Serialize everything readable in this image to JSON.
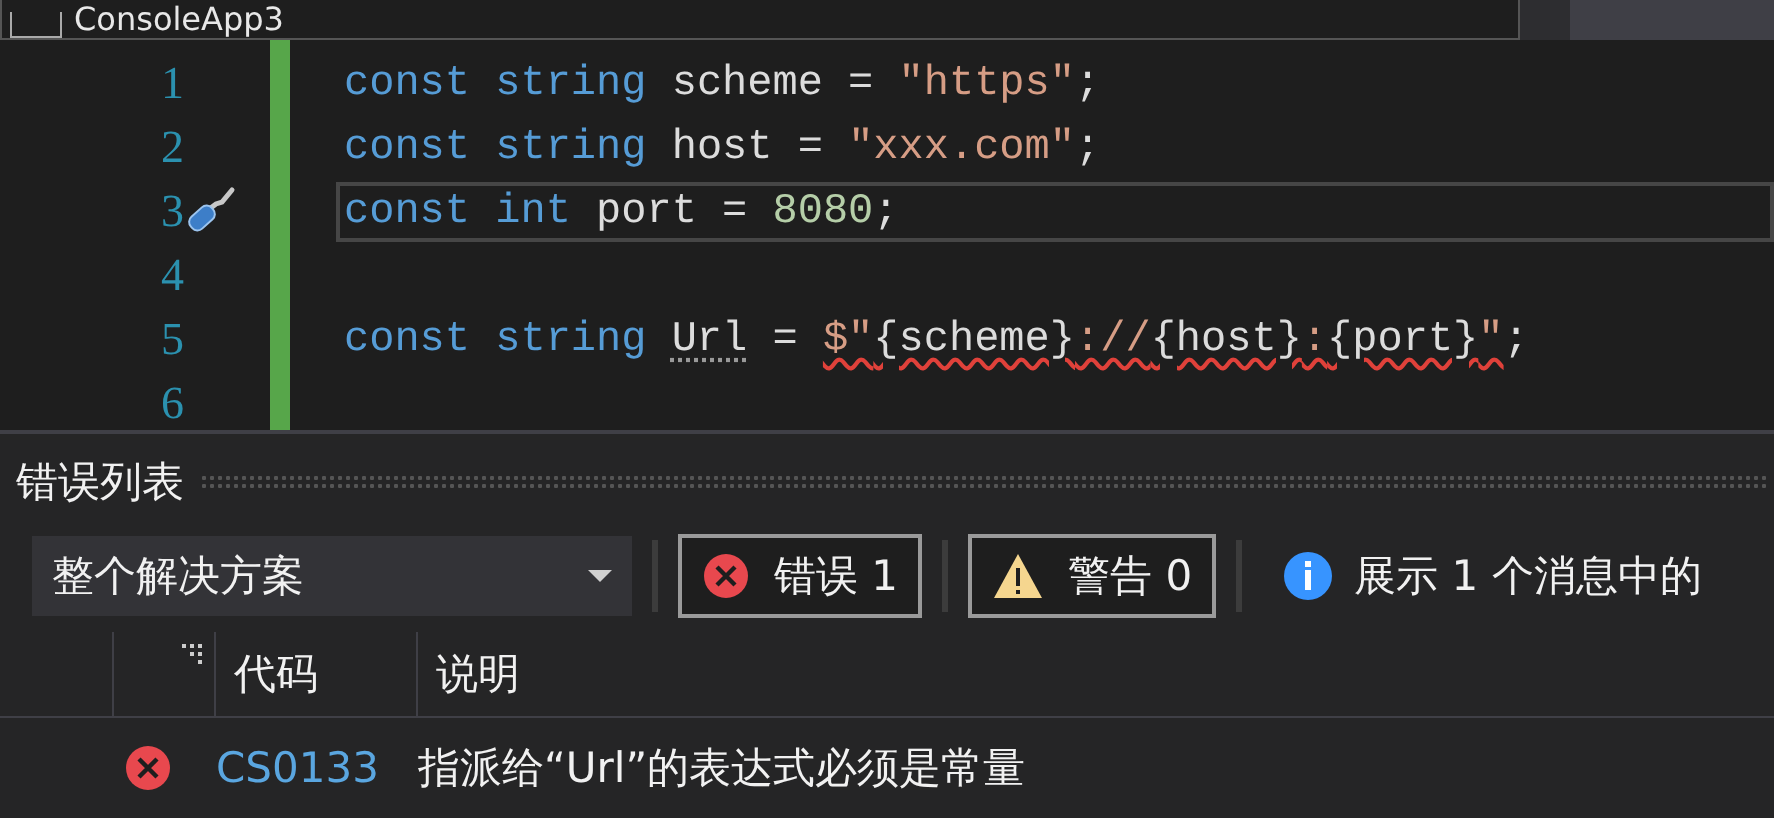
{
  "window": {
    "title": "ConsoleApp3"
  },
  "editor": {
    "lines": [
      {
        "number": "1",
        "current": false,
        "quick_action": false,
        "tokens": [
          {
            "kind": "keyword",
            "text": "const string"
          },
          {
            "kind": "plain",
            "text": " scheme = "
          },
          {
            "kind": "string",
            "text": "\"https\""
          },
          {
            "kind": "plain",
            "text": ";"
          }
        ]
      },
      {
        "number": "2",
        "current": false,
        "quick_action": false,
        "tokens": [
          {
            "kind": "keyword",
            "text": "const string"
          },
          {
            "kind": "plain",
            "text": " host = "
          },
          {
            "kind": "string",
            "text": "\"xxx.com\""
          },
          {
            "kind": "plain",
            "text": ";"
          }
        ]
      },
      {
        "number": "3",
        "current": true,
        "quick_action": true,
        "tokens": [
          {
            "kind": "keyword",
            "text": "const int"
          },
          {
            "kind": "plain",
            "text": " port = "
          },
          {
            "kind": "number",
            "text": "8080"
          },
          {
            "kind": "plain",
            "text": ";"
          }
        ]
      },
      {
        "number": "4",
        "current": false,
        "quick_action": false
      },
      {
        "number": "5",
        "current": false,
        "quick_action": false,
        "tokens": [
          {
            "kind": "keyword",
            "text": "const string "
          },
          {
            "kind": "hint",
            "text": "Url"
          },
          {
            "kind": "plain",
            "text": " = "
          },
          {
            "kind": "error_string",
            "text": "$\""
          },
          {
            "kind": "error_plain",
            "text": "{scheme}"
          },
          {
            "kind": "error_string",
            "text": "://"
          },
          {
            "kind": "error_plain",
            "text": "{host}"
          },
          {
            "kind": "error_string",
            "text": ":"
          },
          {
            "kind": "error_plain",
            "text": "{port}"
          },
          {
            "kind": "error_string",
            "text": "\""
          },
          {
            "kind": "plain",
            "text": ";"
          }
        ]
      },
      {
        "number": "6",
        "current": false,
        "quick_action": false
      }
    ]
  },
  "error_list": {
    "title": "错误列表",
    "scope": "整个解决方案",
    "filters": [
      {
        "kind": "error",
        "label": "错误 1",
        "selected": true
      },
      {
        "kind": "warning",
        "label": "警告 0",
        "selected": true
      }
    ],
    "message_info": "展示 1 个消息中的",
    "columns": [
      "代码",
      "说明"
    ],
    "rows": [
      {
        "code": "CS0133",
        "description": "指派给“Url”的表达式必须是常量"
      }
    ]
  }
}
